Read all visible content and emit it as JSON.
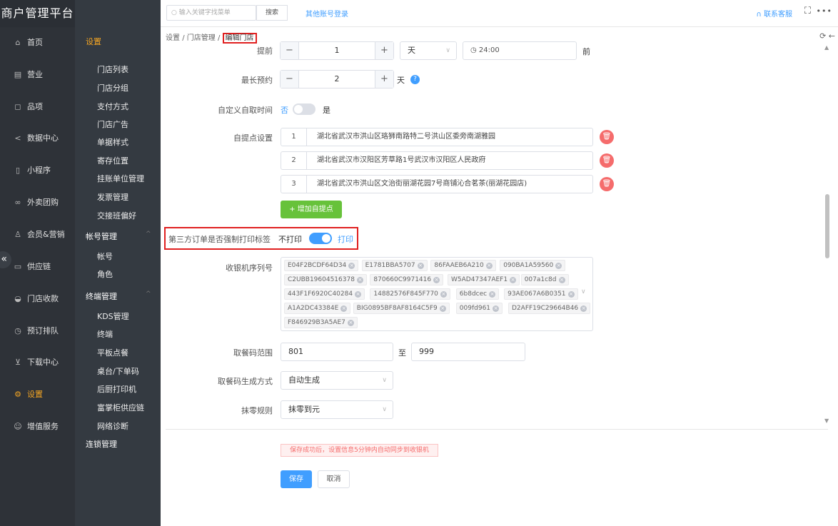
{
  "app": {
    "title": "商户管理平台"
  },
  "nav": {
    "items": [
      {
        "icon": "home-icon",
        "label": "首页"
      },
      {
        "icon": "report-icon",
        "label": "营业"
      },
      {
        "icon": "bag-icon",
        "label": "品项"
      },
      {
        "icon": "share-icon",
        "label": "数据中心"
      },
      {
        "icon": "mobile-icon",
        "label": "小程序"
      },
      {
        "icon": "takeout-icon",
        "label": "外卖团购"
      },
      {
        "icon": "user-icon",
        "label": "会员&营销"
      },
      {
        "icon": "truck-icon",
        "label": "供应链"
      },
      {
        "icon": "wallet-icon",
        "label": "门店收款"
      },
      {
        "icon": "clock-icon",
        "label": "预订排队"
      },
      {
        "icon": "download-icon",
        "label": "下载中心"
      },
      {
        "icon": "gear-icon",
        "label": "设置"
      },
      {
        "icon": "gift-icon",
        "label": "增值服务"
      }
    ],
    "active": "设置"
  },
  "submenu": {
    "title": "设置",
    "store_items": [
      "门店列表",
      "门店分组",
      "支付方式",
      "门店广告",
      "单据样式",
      "寄存位置",
      "挂账单位管理",
      "发票管理",
      "交接班偏好"
    ],
    "account_group": "帐号管理",
    "account_items": [
      "帐号",
      "角色"
    ],
    "terminal_group": "终端管理",
    "terminal_items": [
      "KDS管理",
      "终端",
      "平板点餐",
      "桌台/下单码",
      "后厨打印机",
      "富掌柜供应链",
      "网络诊断"
    ],
    "chain_group": "连锁管理"
  },
  "topbar": {
    "search_placeholder": "输入关键字找菜单",
    "search_button": "搜索",
    "other_login": "其他账号登录",
    "contact": "联系客服"
  },
  "breadcrumb": {
    "settings": "设置",
    "store_mgmt": "门店管理",
    "current": "编辑门店",
    "sep": "/"
  },
  "form": {
    "advance": {
      "label": "提前",
      "value": "1",
      "unit": "天",
      "time": "24:00",
      "suffix": "前"
    },
    "max_booking": {
      "label": "最长预约",
      "value": "2",
      "unit": "天"
    },
    "custom_pickup": {
      "label": "自定义自取时间",
      "off": "否",
      "on": "是",
      "enabled": false
    },
    "pickup_points": {
      "label": "自提点设置",
      "rows": [
        {
          "no": "1",
          "address": "湖北省武汉市洪山区珞狮南路特二号洪山区委旁南湖雅园"
        },
        {
          "no": "2",
          "address": "湖北省武汉市汉阳区芳草路1号武汉市汉阳区人民政府"
        },
        {
          "no": "3",
          "address": "湖北省武汉市洪山区文治街丽湖花园7号商铺沁合茗茶(丽湖花园店)"
        }
      ],
      "add_button": "+ 增加自提点"
    },
    "force_print": {
      "label": "第三方订单是否强制打印标签",
      "off": "不打印",
      "on": "打印",
      "enabled": true
    },
    "cashier_serials": {
      "label": "收银机序列号",
      "tags": [
        "E04F2BCDF64D34",
        "E1781BBA5707",
        "86FAAEB6A210",
        "090BA1A59560",
        "C2UBB19604516378",
        "870660C9971416",
        "W5AD47347AEF1",
        "007a1c8d",
        "443F1F6920C40284",
        "14882576F845F770",
        "6b8dcec",
        "93AE067A6B0351",
        "A1A2DC43384E",
        "BIG0895BF8AF8164C5F9",
        "009fd961",
        "D2AFF19C29664B46",
        "F846929B3A5AE7"
      ]
    },
    "pickup_code": {
      "label": "取餐码范围",
      "from": "801",
      "to_label": "至",
      "to": "999"
    },
    "code_gen": {
      "label": "取餐码生成方式",
      "value": "自动生成"
    },
    "rounding": {
      "label": "抹零规则",
      "value": "抹零到元"
    }
  },
  "footer": {
    "notice": "保存成功后，设置信息5分钟内自动同步到收银机",
    "save": "保存",
    "cancel": "取消"
  },
  "colors": {
    "primary": "#409eff",
    "success": "#67c23a",
    "danger": "#f56c6c",
    "sidebar": "#2e3238",
    "active": "#f5a623",
    "highlight": "#e02020"
  }
}
